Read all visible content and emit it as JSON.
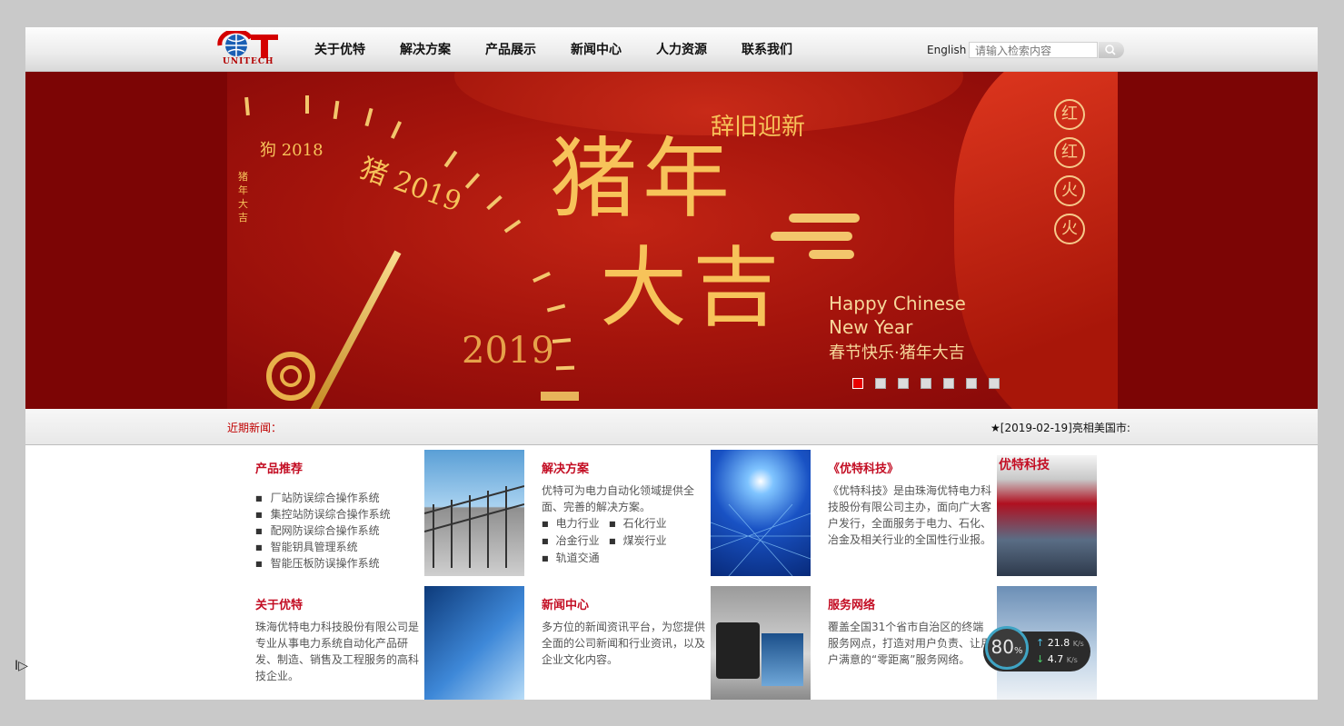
{
  "header": {
    "logo_text": "UNITECH",
    "nav": [
      "关于优特",
      "解决方案",
      "产品展示",
      "新闻中心",
      "人力资源",
      "联系我们"
    ],
    "lang": "English",
    "search_placeholder": "请输入检索内容"
  },
  "banner": {
    "top_text": "辞旧迎新",
    "big1": "猪年",
    "big2": "大吉",
    "en1": "Happy Chinese",
    "en2": "New Year",
    "cn": "春节快乐·猪年大吉",
    "year": "2019",
    "zhu": "猪 2019",
    "gou": "狗 2018",
    "side": "猪年大吉",
    "circles": [
      "红",
      "红",
      "火",
      "火"
    ],
    "slide_count": 7,
    "active_slide": 1
  },
  "newsbar": {
    "label": "近期新闻：",
    "ticker": "★[2019-02-19]亮相美国市:"
  },
  "products": {
    "title": "产品推荐",
    "items": [
      "厂站防误综合操作系统",
      "集控站防误综合操作系统",
      "配网防误综合操作系统",
      "智能钥具管理系统",
      "智能压板防误操作系统"
    ]
  },
  "solutions": {
    "title": "解决方案",
    "desc": "优特可为电力自动化领域提供全面、完善的解决方案。",
    "items": [
      "电力行业",
      "石化行业",
      "冶金行业",
      "煤炭行业",
      "轨道交通"
    ]
  },
  "magazine": {
    "title": "《优特科技》",
    "desc": "《优特科技》是由珠海优特电力科技股份有限公司主办，面向广大客户发行，全面服务于电力、石化、冶金及相关行业的全国性行业报。",
    "cover_title": "优特科技"
  },
  "about": {
    "title": "关于优特",
    "desc": "珠海优特电力科技股份有限公司是专业从事电力系统自动化产品研发、制造、销售及工程服务的高科技企业。"
  },
  "news": {
    "title": "新闻中心",
    "desc": "多方位的新闻资讯平台，为您提供全面的公司新闻和行业资讯，以及企业文化内容。"
  },
  "service": {
    "title": "服务网络",
    "desc": "覆盖全国31个省市自治区的终端服务网点，打造对用户负责、让用户满意的“零距离”服务网络。"
  },
  "speed": {
    "percent": "80",
    "percent_sign": "%",
    "up": "21.8",
    "down": "4.7",
    "unit": "K/s"
  },
  "colors": {
    "accent": "#c30d23",
    "banner_bg": "#7c0505",
    "gold": "#f7c35a"
  }
}
